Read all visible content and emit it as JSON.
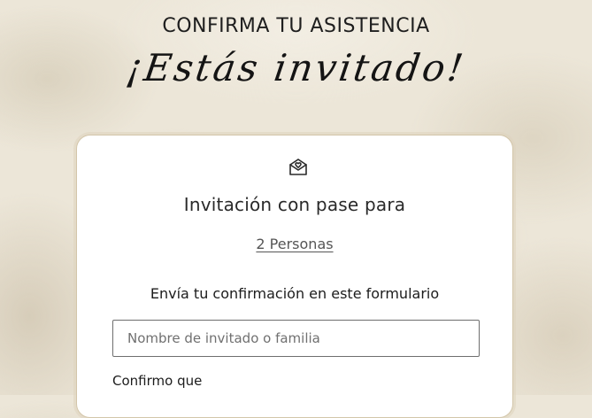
{
  "header": {
    "subtitle": "CONFIRMA TU ASISTENCIA",
    "script_title": "¡Estás invitado!"
  },
  "card": {
    "icon": "mail-heart-icon",
    "title": "Invitación con pase para",
    "pass_link": "2 Personas",
    "instruction": "Envía tu confirmación en este formulario",
    "name_field": {
      "placeholder": "Nombre de invitado o familia",
      "value": ""
    },
    "confirm_label": "Confirmo que"
  },
  "colors": {
    "background": "#ece6d8",
    "card_border": "#d3c6aa",
    "text": "#1e1e1e"
  }
}
